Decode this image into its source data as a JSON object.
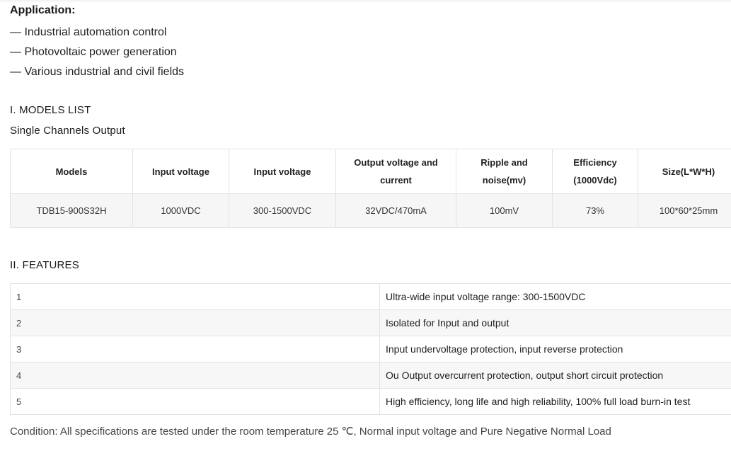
{
  "application": {
    "title": "Application:",
    "items": [
      "— Industrial automation control",
      "— Photovoltaic power generation",
      "— Various industrial and civil fields"
    ]
  },
  "models_section": {
    "heading": "I. MODELS LIST",
    "subheading": "Single Channels Output",
    "table": {
      "headers": [
        "Models",
        "Input voltage",
        "Input voltage",
        "Output voltage and current",
        "Ripple and noise(mv)",
        "Efficiency (1000Vdc)",
        "Size(L*W*H)"
      ],
      "rows": [
        [
          "TDB15-900S32H",
          "1000VDC",
          "300-1500VDC",
          "32VDC/470mA",
          "100mV",
          "73%",
          "100*60*25mm"
        ]
      ]
    }
  },
  "features_section": {
    "heading": "II. FEATURES",
    "rows": [
      {
        "num": "1",
        "text": "Ultra-wide input voltage range: 300-1500VDC"
      },
      {
        "num": "2",
        "text": "Isolated for Input and output"
      },
      {
        "num": "3",
        "text": "Input undervoltage protection, input reverse protection"
      },
      {
        "num": "4",
        "text": "Ou Output overcurrent protection, output short circuit protection"
      },
      {
        "num": "5",
        "text": "High efficiency, long life and high reliability, 100% full load burn-in test"
      }
    ]
  },
  "condition": "Condition: All specifications are tested under the room temperature 25 ℃, Normal input voltage and Pure Negative Normal Load"
}
